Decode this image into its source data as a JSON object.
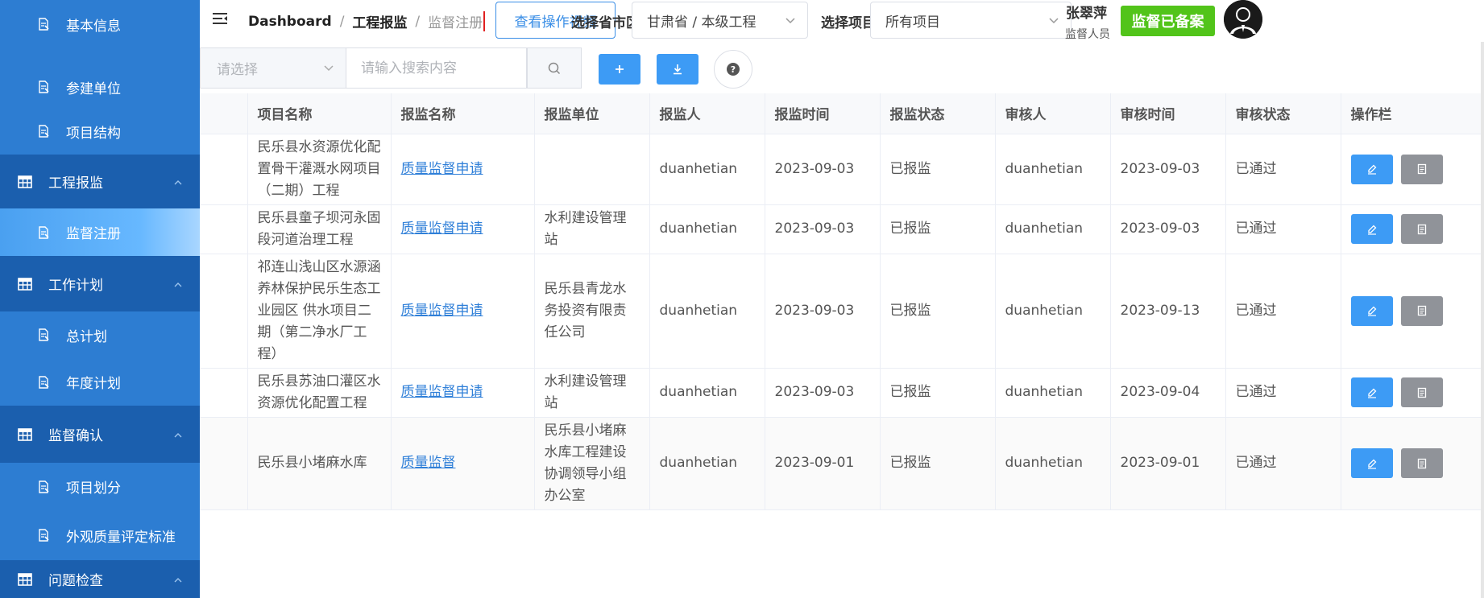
{
  "sidebar": {
    "items": [
      {
        "label": "基本信息",
        "type": "sub",
        "active": false
      },
      {
        "label": "参建单位",
        "type": "sub",
        "active": false
      },
      {
        "label": "项目结构",
        "type": "sub",
        "active": false
      },
      {
        "label": "工程报监",
        "type": "group",
        "active": false
      },
      {
        "label": "监督注册",
        "type": "sub",
        "active": true
      },
      {
        "label": "工作计划",
        "type": "group",
        "active": false
      },
      {
        "label": "总计划",
        "type": "sub",
        "active": false
      },
      {
        "label": "年度计划",
        "type": "sub",
        "active": false
      },
      {
        "label": "监督确认",
        "type": "group",
        "active": false
      },
      {
        "label": "项目划分",
        "type": "sub",
        "active": false
      },
      {
        "label": "外观质量评定标准",
        "type": "sub",
        "active": false
      },
      {
        "label": "问题检查",
        "type": "group",
        "active": false
      }
    ]
  },
  "header": {
    "breadcrumb": [
      "Dashboard",
      "工程报监",
      "监督注册"
    ],
    "video_button": "查看操作视频",
    "region_label": "选择省市区",
    "region_value": "甘肃省 / 本级工程",
    "project_label": "选择项目",
    "project_value": "所有项目",
    "user_name": "张翠萍",
    "user_role": "监督人员",
    "status_badge": "监督已备案"
  },
  "toolbar": {
    "filter_placeholder": "请选择",
    "search_placeholder": "请输入搜索内容"
  },
  "table": {
    "columns": [
      "",
      "项目名称",
      "报监名称",
      "报监单位",
      "报监人",
      "报监时间",
      "报监状态",
      "审核人",
      "审核时间",
      "审核状态",
      "操作栏"
    ],
    "rows": [
      {
        "project": "民乐县水资源优化配置骨干灌溉水网项目（二期）工程",
        "report_name": "质量监督申请",
        "unit": "",
        "reporter": "duanhetian",
        "report_time": "2023-09-03",
        "report_status": "已报监",
        "reviewer": "duanhetian",
        "review_time": "2023-09-03",
        "review_status": "已通过"
      },
      {
        "project": "民乐县童子坝河永固段河道治理工程",
        "report_name": "质量监督申请",
        "unit": "水利建设管理站",
        "reporter": "duanhetian",
        "report_time": "2023-09-03",
        "report_status": "已报监",
        "reviewer": "duanhetian",
        "review_time": "2023-09-03",
        "review_status": "已通过"
      },
      {
        "project": "祁连山浅山区水源涵养林保护民乐生态工业园区 供水项目二期（第二净水厂工程）",
        "report_name": "质量监督申请",
        "unit": "民乐县青龙水务投资有限责任公司",
        "reporter": "duanhetian",
        "report_time": "2023-09-03",
        "report_status": "已报监",
        "reviewer": "duanhetian",
        "review_time": "2023-09-13",
        "review_status": "已通过"
      },
      {
        "project": "民乐县苏油口灌区水资源优化配置工程",
        "report_name": "质量监督申请",
        "unit": "水利建设管理站",
        "reporter": "duanhetian",
        "report_time": "2023-09-03",
        "report_status": "已报监",
        "reviewer": "duanhetian",
        "review_time": "2023-09-04",
        "review_status": "已通过"
      },
      {
        "project": "民乐县小堵麻水库",
        "report_name": "质量监督",
        "unit": "民乐县小堵麻水库工程建设协调领导小组办公室",
        "reporter": "duanhetian",
        "report_time": "2023-09-01",
        "report_status": "已报监",
        "reviewer": "duanhetian",
        "review_time": "2023-09-01",
        "review_status": "已通过"
      }
    ]
  },
  "colors": {
    "sidebar_bg": "#2d7dd2",
    "sidebar_group_bg": "#1b5fae",
    "primary": "#3d9bf5",
    "success": "#52c41a",
    "link": "#2f7fd8"
  }
}
